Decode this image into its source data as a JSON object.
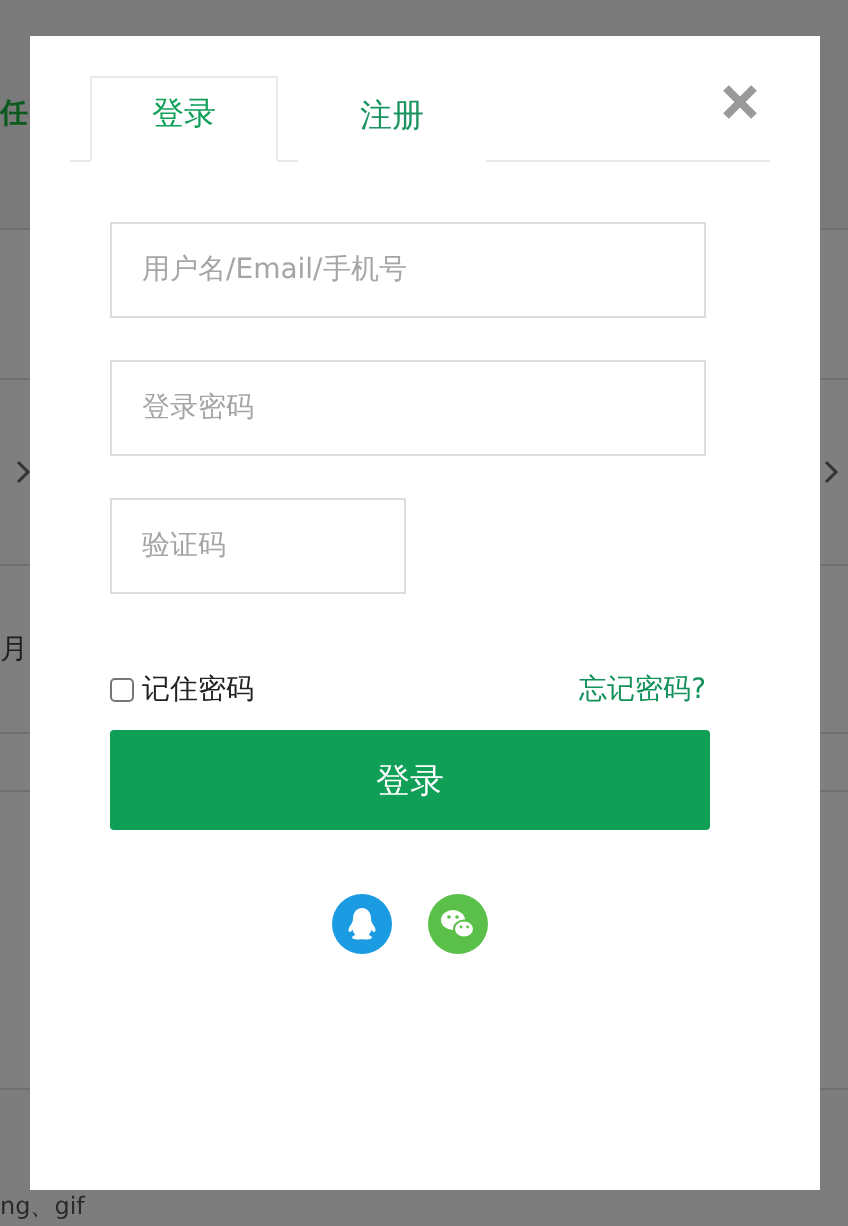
{
  "background": {
    "fragments": [
      {
        "kind": "green",
        "text": "任"
      },
      {
        "kind": "chevron"
      },
      {
        "kind": "plain",
        "text": "月"
      },
      {
        "kind": "footer",
        "text": "ng、gif"
      }
    ]
  },
  "dialog": {
    "tabs": [
      {
        "label": "登录",
        "selected": true
      },
      {
        "label": "注册",
        "selected": false
      }
    ],
    "fields": [
      {
        "placeholder": "用户名/Email/手机号",
        "kind": "wide"
      },
      {
        "placeholder": "登录密码",
        "kind": "wide"
      },
      {
        "placeholder": "验证码",
        "kind": "short"
      }
    ],
    "remember": {
      "label": "记住密码",
      "checked": false
    },
    "forgot": "忘记密码?",
    "submit": "登录",
    "social": [
      {
        "kind": "qq",
        "color": "#1a9be2"
      },
      {
        "kind": "wechat",
        "color": "#5ac04a"
      }
    ]
  }
}
